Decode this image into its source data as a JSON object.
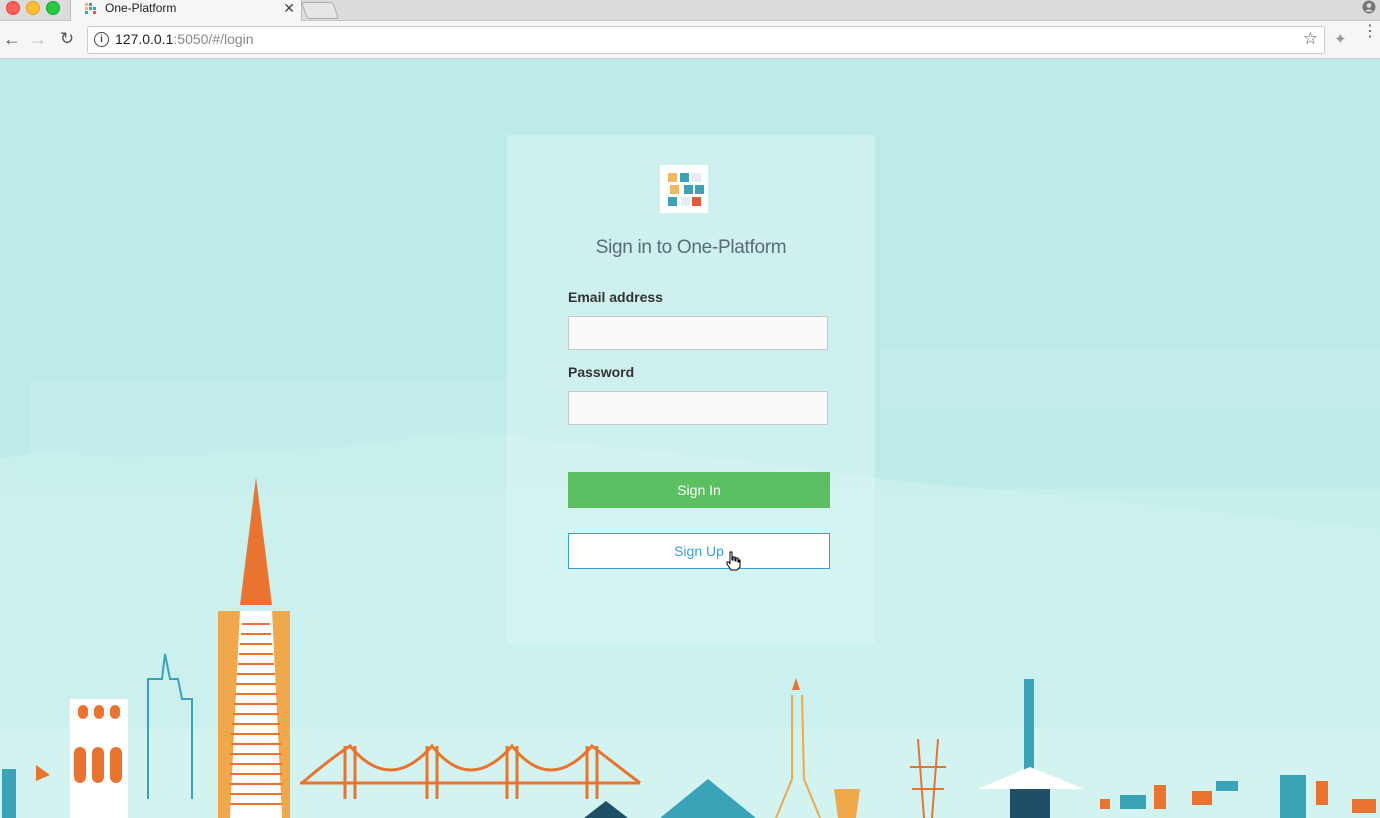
{
  "browser": {
    "tab_title": "One-Platform",
    "tab_close": "✕",
    "url_host": "127.0.0.1",
    "url_rest": ":5050/#/login",
    "info_glyph": "i"
  },
  "login": {
    "title": "Sign in to One-Platform",
    "email_label": "Email address",
    "email_value": "",
    "password_label": "Password",
    "password_value": "",
    "signin_label": "Sign In",
    "signup_label": "Sign Up"
  },
  "colors": {
    "background": "#bdebe8",
    "signin_green": "#5cc063",
    "signup_blue": "#3a9fd8",
    "skyline_orange": "#e8742f",
    "skyline_teal": "#3aa3b8"
  }
}
